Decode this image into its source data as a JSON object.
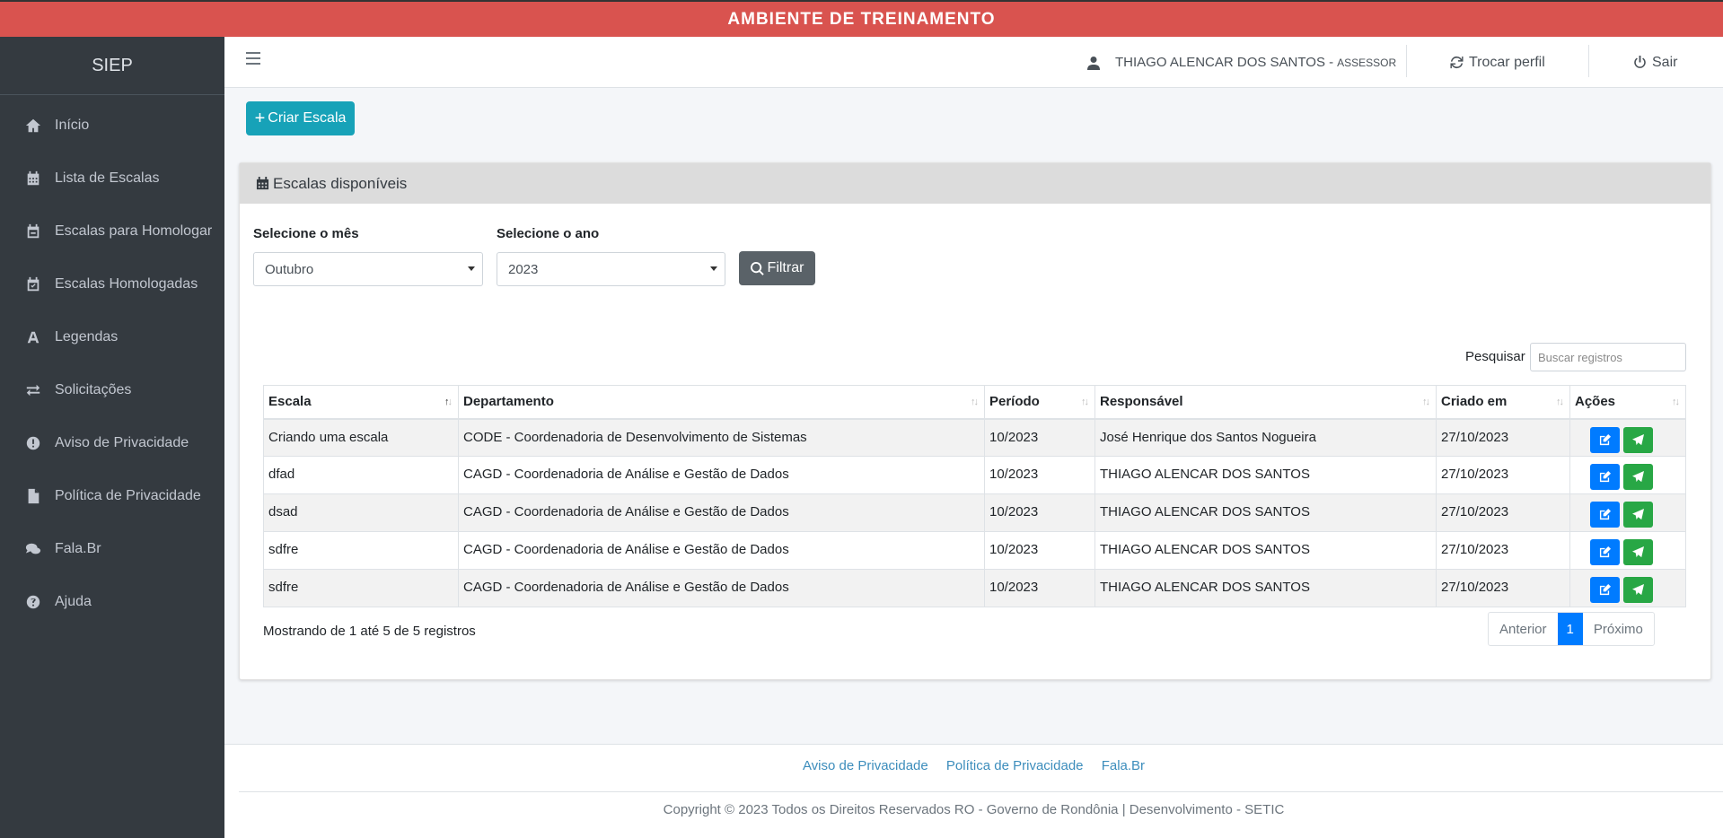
{
  "banner": "AMBIENTE DE TREINAMENTO",
  "sidebar": {
    "brand": "SIEP",
    "items": [
      {
        "label": "Início",
        "icon": "home-icon"
      },
      {
        "label": "Lista de Escalas",
        "icon": "calendar-grid-icon"
      },
      {
        "label": "Escalas para Homologar",
        "icon": "calendar-minus-icon"
      },
      {
        "label": "Escalas Homologadas",
        "icon": "calendar-check-icon"
      },
      {
        "label": "Legendas",
        "icon": "font-icon"
      },
      {
        "label": "Solicitações",
        "icon": "exchange-icon"
      },
      {
        "label": "Aviso de Privacidade",
        "icon": "exclamation-circle-icon"
      },
      {
        "label": "Política de Privacidade",
        "icon": "file-icon"
      },
      {
        "label": "Fala.Br",
        "icon": "comments-icon"
      },
      {
        "label": "Ajuda",
        "icon": "question-circle-icon"
      }
    ]
  },
  "header": {
    "user_name": "THIAGO ALENCAR DOS SANTOS -",
    "user_role": "Assessor",
    "switch_profile": "Trocar perfil",
    "logout": "Sair"
  },
  "create_button": "Criar Escala",
  "card": {
    "title": "Escalas disponíveis",
    "month_label": "Selecione o mês",
    "month_value": "Outubro",
    "year_label": "Selecione o ano",
    "year_value": "2023",
    "filter_button": "Filtrar",
    "search_label": "Pesquisar",
    "search_placeholder": "Buscar registros"
  },
  "table": {
    "columns": [
      "Escala",
      "Departamento",
      "Período",
      "Responsável",
      "Criado em",
      "Ações"
    ],
    "rows": [
      [
        "Criando uma escala",
        "CODE - Coordenadoria de Desenvolvimento de Sistemas",
        "10/2023",
        "José Henrique dos Santos Nogueira",
        "27/10/2023"
      ],
      [
        "dfad",
        "CAGD - Coordenadoria de Análise e Gestão de Dados",
        "10/2023",
        "THIAGO ALENCAR DOS SANTOS",
        "27/10/2023"
      ],
      [
        "dsad",
        "CAGD - Coordenadoria de Análise e Gestão de Dados",
        "10/2023",
        "THIAGO ALENCAR DOS SANTOS",
        "27/10/2023"
      ],
      [
        "sdfre",
        "CAGD - Coordenadoria de Análise e Gestão de Dados",
        "10/2023",
        "THIAGO ALENCAR DOS SANTOS",
        "27/10/2023"
      ],
      [
        "sdfre",
        "CAGD - Coordenadoria de Análise e Gestão de Dados",
        "10/2023",
        "THIAGO ALENCAR DOS SANTOS",
        "27/10/2023"
      ]
    ]
  },
  "info": "Mostrando de 1 até 5 de 5 registros",
  "pagination": {
    "prev": "Anterior",
    "current": "1",
    "next": "Próximo"
  },
  "footer": {
    "links": [
      "Aviso de Privacidade",
      "Política de Privacidade",
      "Fala.Br"
    ],
    "copyright": "Copyright © 2023 Todos os Direitos Reservados RO - Governo de Rondônia | Desenvolvimento - SETIC"
  },
  "colors": {
    "banner": "#d9534f",
    "sidebar": "#343a40",
    "create": "#17a2b8",
    "edit": "#007bff",
    "send": "#28a745",
    "filter": "#5a6268"
  }
}
